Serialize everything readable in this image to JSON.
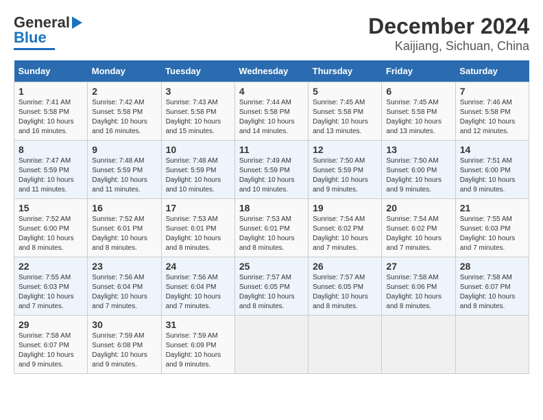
{
  "header": {
    "logo_line1": "General",
    "logo_line2": "Blue",
    "title": "December 2024",
    "subtitle": "Kaijiang, Sichuan, China"
  },
  "calendar": {
    "days_of_week": [
      "Sunday",
      "Monday",
      "Tuesday",
      "Wednesday",
      "Thursday",
      "Friday",
      "Saturday"
    ],
    "weeks": [
      [
        {
          "day": "1",
          "info": "Sunrise: 7:41 AM\nSunset: 5:58 PM\nDaylight: 10 hours\nand 16 minutes."
        },
        {
          "day": "2",
          "info": "Sunrise: 7:42 AM\nSunset: 5:58 PM\nDaylight: 10 hours\nand 16 minutes."
        },
        {
          "day": "3",
          "info": "Sunrise: 7:43 AM\nSunset: 5:58 PM\nDaylight: 10 hours\nand 15 minutes."
        },
        {
          "day": "4",
          "info": "Sunrise: 7:44 AM\nSunset: 5:58 PM\nDaylight: 10 hours\nand 14 minutes."
        },
        {
          "day": "5",
          "info": "Sunrise: 7:45 AM\nSunset: 5:58 PM\nDaylight: 10 hours\nand 13 minutes."
        },
        {
          "day": "6",
          "info": "Sunrise: 7:45 AM\nSunset: 5:58 PM\nDaylight: 10 hours\nand 13 minutes."
        },
        {
          "day": "7",
          "info": "Sunrise: 7:46 AM\nSunset: 5:58 PM\nDaylight: 10 hours\nand 12 minutes."
        }
      ],
      [
        {
          "day": "8",
          "info": "Sunrise: 7:47 AM\nSunset: 5:59 PM\nDaylight: 10 hours\nand 11 minutes."
        },
        {
          "day": "9",
          "info": "Sunrise: 7:48 AM\nSunset: 5:59 PM\nDaylight: 10 hours\nand 11 minutes."
        },
        {
          "day": "10",
          "info": "Sunrise: 7:48 AM\nSunset: 5:59 PM\nDaylight: 10 hours\nand 10 minutes."
        },
        {
          "day": "11",
          "info": "Sunrise: 7:49 AM\nSunset: 5:59 PM\nDaylight: 10 hours\nand 10 minutes."
        },
        {
          "day": "12",
          "info": "Sunrise: 7:50 AM\nSunset: 5:59 PM\nDaylight: 10 hours\nand 9 minutes."
        },
        {
          "day": "13",
          "info": "Sunrise: 7:50 AM\nSunset: 6:00 PM\nDaylight: 10 hours\nand 9 minutes."
        },
        {
          "day": "14",
          "info": "Sunrise: 7:51 AM\nSunset: 6:00 PM\nDaylight: 10 hours\nand 9 minutes."
        }
      ],
      [
        {
          "day": "15",
          "info": "Sunrise: 7:52 AM\nSunset: 6:00 PM\nDaylight: 10 hours\nand 8 minutes."
        },
        {
          "day": "16",
          "info": "Sunrise: 7:52 AM\nSunset: 6:01 PM\nDaylight: 10 hours\nand 8 minutes."
        },
        {
          "day": "17",
          "info": "Sunrise: 7:53 AM\nSunset: 6:01 PM\nDaylight: 10 hours\nand 8 minutes."
        },
        {
          "day": "18",
          "info": "Sunrise: 7:53 AM\nSunset: 6:01 PM\nDaylight: 10 hours\nand 8 minutes."
        },
        {
          "day": "19",
          "info": "Sunrise: 7:54 AM\nSunset: 6:02 PM\nDaylight: 10 hours\nand 7 minutes."
        },
        {
          "day": "20",
          "info": "Sunrise: 7:54 AM\nSunset: 6:02 PM\nDaylight: 10 hours\nand 7 minutes."
        },
        {
          "day": "21",
          "info": "Sunrise: 7:55 AM\nSunset: 6:03 PM\nDaylight: 10 hours\nand 7 minutes."
        }
      ],
      [
        {
          "day": "22",
          "info": "Sunrise: 7:55 AM\nSunset: 6:03 PM\nDaylight: 10 hours\nand 7 minutes."
        },
        {
          "day": "23",
          "info": "Sunrise: 7:56 AM\nSunset: 6:04 PM\nDaylight: 10 hours\nand 7 minutes."
        },
        {
          "day": "24",
          "info": "Sunrise: 7:56 AM\nSunset: 6:04 PM\nDaylight: 10 hours\nand 7 minutes."
        },
        {
          "day": "25",
          "info": "Sunrise: 7:57 AM\nSunset: 6:05 PM\nDaylight: 10 hours\nand 8 minutes."
        },
        {
          "day": "26",
          "info": "Sunrise: 7:57 AM\nSunset: 6:05 PM\nDaylight: 10 hours\nand 8 minutes."
        },
        {
          "day": "27",
          "info": "Sunrise: 7:58 AM\nSunset: 6:06 PM\nDaylight: 10 hours\nand 8 minutes."
        },
        {
          "day": "28",
          "info": "Sunrise: 7:58 AM\nSunset: 6:07 PM\nDaylight: 10 hours\nand 8 minutes."
        }
      ],
      [
        {
          "day": "29",
          "info": "Sunrise: 7:58 AM\nSunset: 6:07 PM\nDaylight: 10 hours\nand 9 minutes."
        },
        {
          "day": "30",
          "info": "Sunrise: 7:59 AM\nSunset: 6:08 PM\nDaylight: 10 hours\nand 9 minutes."
        },
        {
          "day": "31",
          "info": "Sunrise: 7:59 AM\nSunset: 6:09 PM\nDaylight: 10 hours\nand 9 minutes."
        },
        {
          "day": "",
          "info": ""
        },
        {
          "day": "",
          "info": ""
        },
        {
          "day": "",
          "info": ""
        },
        {
          "day": "",
          "info": ""
        }
      ]
    ]
  }
}
